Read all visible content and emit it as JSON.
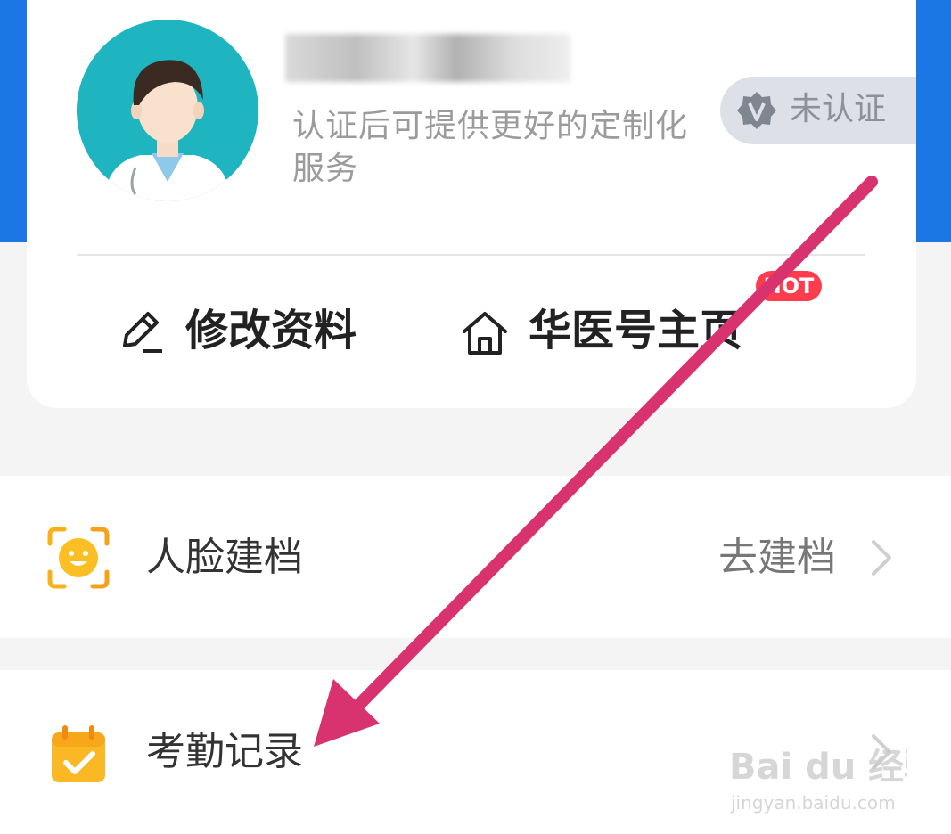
{
  "profile": {
    "subtitle": "认证后可提供更好的定制化服务",
    "verify_label": "未认证"
  },
  "actions": {
    "edit_label": "修改资料",
    "home_label": "华医号主页",
    "hot_badge": "HOT"
  },
  "menu": {
    "face": {
      "label": "人脸建档",
      "value": "去建档",
      "icon": "face-scan-icon"
    },
    "attendance": {
      "label": "考勤记录",
      "icon": "calendar-check-icon"
    }
  },
  "watermark": {
    "brand_text": "Bai du 经验",
    "url": "jingyan.baidu.com"
  },
  "colors": {
    "header_blue": "#1b77e3",
    "hot_red": "#ff3b4e",
    "annotation_arrow": "#d9336f",
    "icon_orange": "#f7b21a"
  }
}
